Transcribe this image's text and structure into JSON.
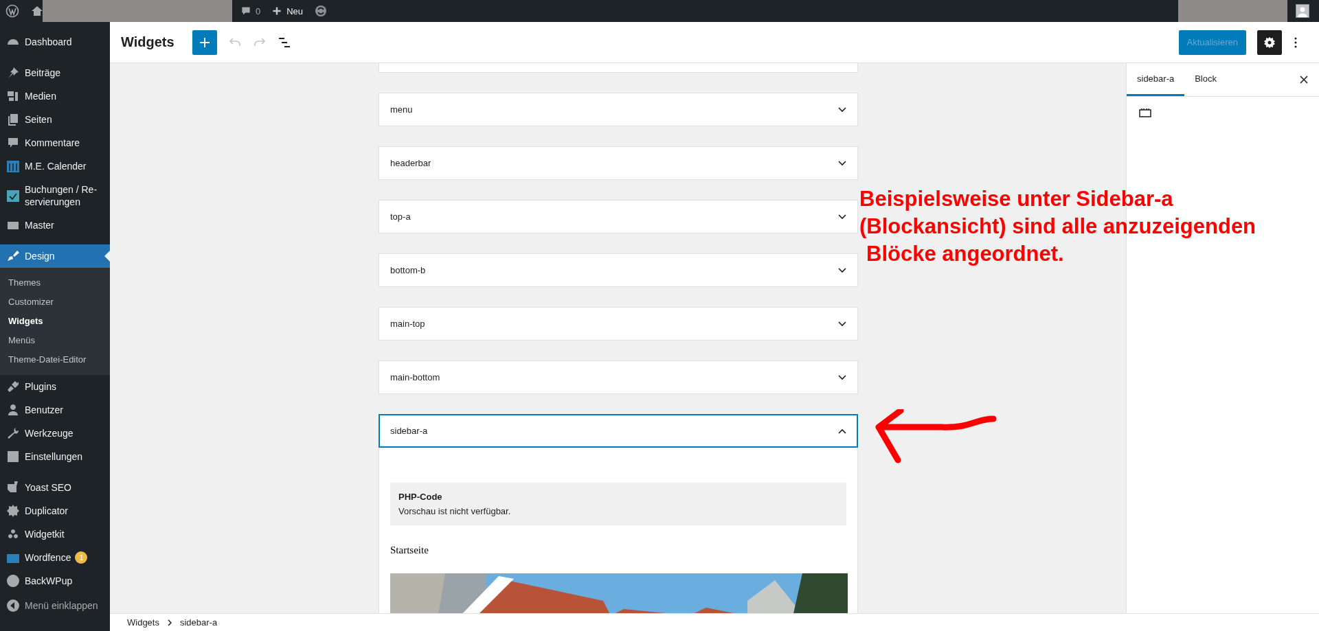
{
  "admin_bar": {
    "comments": "0",
    "new_label": "Neu"
  },
  "sidebar": {
    "items": [
      {
        "label": "Dashboard",
        "selected": false
      },
      {
        "label": "Beiträge",
        "selected": false
      },
      {
        "label": "Medien",
        "selected": false
      },
      {
        "label": "Seiten",
        "selected": false
      },
      {
        "label": "Kommentare",
        "selected": false
      },
      {
        "label": "M.E. Calender",
        "selected": false
      },
      {
        "label": "Buchungen / Re-servierungen",
        "selected": false
      },
      {
        "label": "Master",
        "selected": false
      },
      {
        "label": "Design",
        "selected": true,
        "children": [
          {
            "label": "Themes",
            "selected": false
          },
          {
            "label": "Customizer",
            "selected": false
          },
          {
            "label": "Widgets",
            "selected": true
          },
          {
            "label": "Menüs",
            "selected": false
          },
          {
            "label": "Theme-Datei-Editor",
            "selected": false
          }
        ]
      },
      {
        "label": "Plugins",
        "selected": false
      },
      {
        "label": "Benutzer",
        "selected": false
      },
      {
        "label": "Werkzeuge",
        "selected": false
      },
      {
        "label": "Einstellungen",
        "selected": false
      },
      {
        "label": "Yoast SEO",
        "selected": false
      },
      {
        "label": "Duplicator",
        "selected": false
      },
      {
        "label": "Widgetkit",
        "selected": false
      },
      {
        "label": "Wordfence",
        "selected": false,
        "badge": "1"
      },
      {
        "label": "BackWPup",
        "selected": false
      }
    ],
    "collapse": "Menü einklappen"
  },
  "header": {
    "title": "Widgets",
    "update_button": {
      "label": "Aktualisieren",
      "disabled": true
    }
  },
  "widget_areas": [
    {
      "title": "menu",
      "expanded": false
    },
    {
      "title": "headerbar",
      "expanded": false
    },
    {
      "title": "top-a",
      "expanded": false
    },
    {
      "title": "bottom-b",
      "expanded": false
    },
    {
      "title": "main-top",
      "expanded": false
    },
    {
      "title": "main-bottom",
      "expanded": false
    },
    {
      "title": "sidebar-a",
      "expanded": true,
      "blocks": [
        {
          "kind": "placeholder",
          "title": "PHP-Code",
          "text": "Vorschau ist nicht verfügbar."
        },
        {
          "kind": "heading",
          "text": "Startseite"
        },
        {
          "kind": "picture"
        }
      ]
    }
  ],
  "inspector": {
    "tabs": [
      {
        "label": "sidebar-a",
        "selected": true
      },
      {
        "label": "Block",
        "selected": false
      }
    ]
  },
  "breadcrumb": [
    "Widgets",
    "sidebar-a"
  ],
  "annotation": {
    "lines": [
      "Beispielsweise unter Sidebar-a",
      "(Blockansicht) sind alle anzuzeigenden",
      "Blöcke angeordnet."
    ]
  }
}
